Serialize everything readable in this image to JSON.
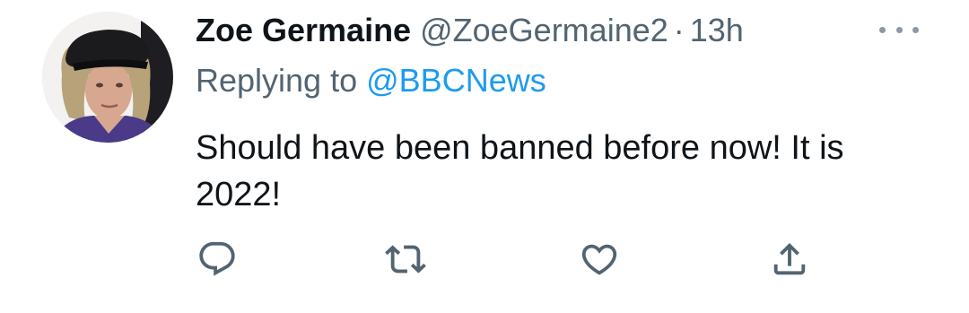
{
  "tweet": {
    "display_name": "Zoe Germaine",
    "handle": "@ZoeGermaine2",
    "separator": "·",
    "time": "13h",
    "reply_prefix": "Replying to",
    "reply_target": "@BBCNews",
    "text": "Should have been banned before now! It is 2022!"
  },
  "actions": [
    {
      "name": "reply",
      "icon": "reply-icon"
    },
    {
      "name": "retweet",
      "icon": "retweet-icon"
    },
    {
      "name": "like",
      "icon": "heart-icon"
    },
    {
      "name": "share",
      "icon": "share-icon"
    }
  ],
  "colors": {
    "text_primary": "#0f1419",
    "text_secondary": "#536471",
    "link": "#1d9bf0",
    "icon": "#536471"
  }
}
